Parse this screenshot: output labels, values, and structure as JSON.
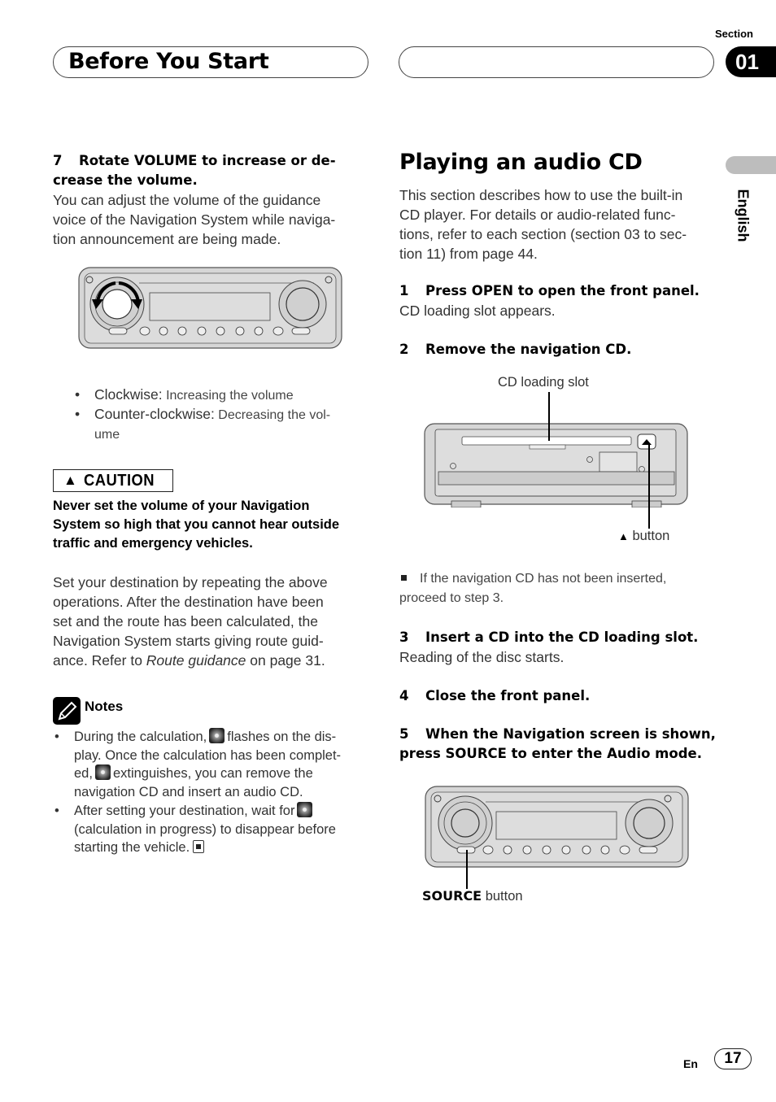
{
  "header": {
    "title": "Before You Start",
    "section_label": "Section",
    "section_number": "01",
    "language": "English"
  },
  "left": {
    "step7": {
      "number": "7",
      "line1": "Rotate VOLUME to increase or de-",
      "line2": "crease the volume.",
      "body": [
        "You can adjust the volume of the guidance",
        "voice of the Navigation System while naviga-",
        "tion announcement are being made."
      ]
    },
    "figure1_alt": "Head unit with VOLUME knob rotation arrows",
    "bullets": [
      {
        "label": "Clockwise:",
        "text": " Increasing the volume"
      },
      {
        "label": "Counter-clockwise:",
        "text": " Decreasing the vol-",
        "cont": "ume"
      }
    ],
    "caution": {
      "icon": "warning-triangle-icon",
      "label": "CAUTION",
      "lines": [
        "Never set the volume of your Navigation",
        "System so high that you cannot hear outside",
        "traffic and emergency vehicles."
      ]
    },
    "paragraph": {
      "lines": [
        "Set your destination by repeating the above",
        "operations. After the destination have been",
        "set and the route has been calculated, the",
        "Navigation System starts giving route guid-"
      ],
      "last_pre": "ance. Refer to ",
      "last_italic": "Route guidance",
      "last_post": " on page 31."
    },
    "notes": {
      "title": "Notes",
      "items": [
        {
          "l1a": "During the calculation,",
          "l1b": "flashes on the dis-",
          "l2": "play. Once the calculation has been complet-",
          "l3a": "ed,",
          "l3b": "extinguishes, you can remove the",
          "l4": "navigation CD and insert an audio CD."
        },
        {
          "l1a": "After setting your destination, wait for",
          "l2": "(calculation in progress) to disappear before",
          "l3": "starting the vehicle."
        }
      ]
    }
  },
  "right": {
    "title": "Playing an audio CD",
    "intro": [
      "This section describes how to use the built-in",
      "CD player. For details or audio-related func-",
      "tions, refer to each section (section 03 to sec-",
      "tion 11) from page 44."
    ],
    "steps": [
      {
        "number": "1",
        "title": "Press OPEN to open the front panel.",
        "body": "CD loading slot appears."
      },
      {
        "number": "2",
        "title": "Remove the navigation CD."
      },
      {
        "number": "3",
        "title": "Insert a CD into the CD loading slot.",
        "body": "Reading of the disc starts."
      },
      {
        "number": "4",
        "title": "Close the front panel."
      },
      {
        "number": "5",
        "title_l1": "When the Navigation screen is shown,",
        "title_l2": "press SOURCE to enter the Audio mode."
      }
    ],
    "figure2": {
      "callout_slot": "CD loading slot",
      "callout_eject_icon": "▲",
      "callout_eject": " button"
    },
    "note": {
      "l1": "If the navigation CD has not been inserted,",
      "l2": "proceed to step 3."
    },
    "figure3": {
      "callout_bold": "SOURCE",
      "callout_rest": " button"
    }
  },
  "footer": {
    "lang_code": "En",
    "page_number": "17"
  }
}
